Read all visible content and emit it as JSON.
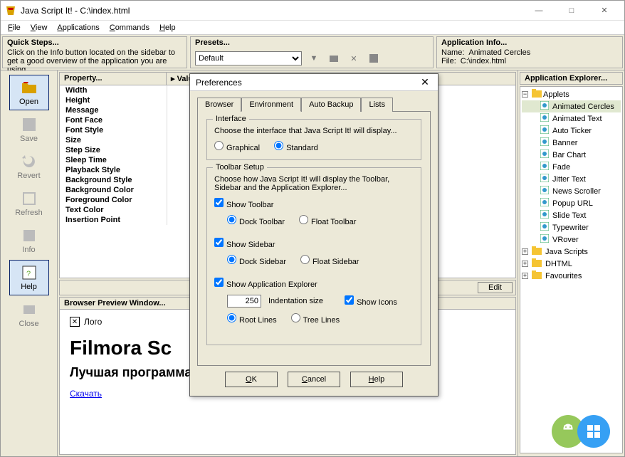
{
  "window": {
    "title": "Java Script It! - C:\\index.html",
    "minimize": "—",
    "maximize": "□",
    "close": "✕"
  },
  "menu": {
    "file": "File",
    "view": "View",
    "applications": "Applications",
    "commands": "Commands",
    "help": "Help"
  },
  "quick": {
    "header": "Quick Steps...",
    "text": "Click on the Info button located on the sidebar to get a good overview of the application you are using."
  },
  "presets": {
    "header": "Presets...",
    "selected": "Default"
  },
  "appinfo": {
    "header": "Application Info...",
    "name_label": "Name:",
    "name_value": "Animated Cercles",
    "file_label": "File:",
    "file_value": "C:\\index.html"
  },
  "sidebar": {
    "open": "Open",
    "save": "Save",
    "revert": "Revert",
    "refresh": "Refresh",
    "info": "Info",
    "help": "Help",
    "close": "Close"
  },
  "propgrid": {
    "col_property": "Property...",
    "col_value": "▸ Value",
    "rows": [
      "Width",
      "Height",
      "Message",
      "Font Face",
      "Font Style",
      "Size",
      "Step Size",
      "Sleep Time",
      "Playback Style",
      "Background Style",
      "Background Color",
      "Foreground Color",
      "Text Color",
      "Insertion Point"
    ]
  },
  "edit_btn": "Edit",
  "preview": {
    "header": "Browser Preview Window...",
    "logo_label": "Лого",
    "h1": "Filmora Sc",
    "h2": "Лучшая программа для записи видео с экрана",
    "link": "Скачать"
  },
  "explorer": {
    "header": "Application Explorer...",
    "root": "Applets",
    "items": [
      "Animated Cercles",
      "Animated Text",
      "Auto Ticker",
      "Banner",
      "Bar Chart",
      "Fade",
      "Jitter Text",
      "News Scroller",
      "Popup URL",
      "Slide Text",
      "Typewriter",
      "VRover"
    ],
    "folders": [
      "Java Scripts",
      "DHTML",
      "Favourites"
    ]
  },
  "dialog": {
    "title": "Preferences",
    "close": "✕",
    "tabs": {
      "browser": "Browser",
      "environment": "Environment",
      "autobackup": "Auto Backup",
      "lists": "Lists"
    },
    "interface": {
      "legend": "Interface",
      "desc": "Choose the interface that Java Script It! will display...",
      "graphical": "Graphical",
      "standard": "Standard"
    },
    "toolbar": {
      "legend": "Toolbar Setup",
      "desc": "Choose how Java Script It! will display the Toolbar, Sidebar and the Application Explorer...",
      "show_toolbar": "Show Toolbar",
      "dock_toolbar": "Dock Toolbar",
      "float_toolbar": "Float Toolbar",
      "show_sidebar": "Show Sidebar",
      "dock_sidebar": "Dock Sidebar",
      "float_sidebar": "Float Sidebar",
      "show_explorer": "Show Application Explorer",
      "indent_value": "250",
      "indent_label": "Indentation size",
      "show_icons": "Show Icons",
      "root_lines": "Root Lines",
      "tree_lines": "Tree Lines"
    },
    "buttons": {
      "ok": "OK",
      "cancel": "Cancel",
      "help": "Help"
    }
  }
}
